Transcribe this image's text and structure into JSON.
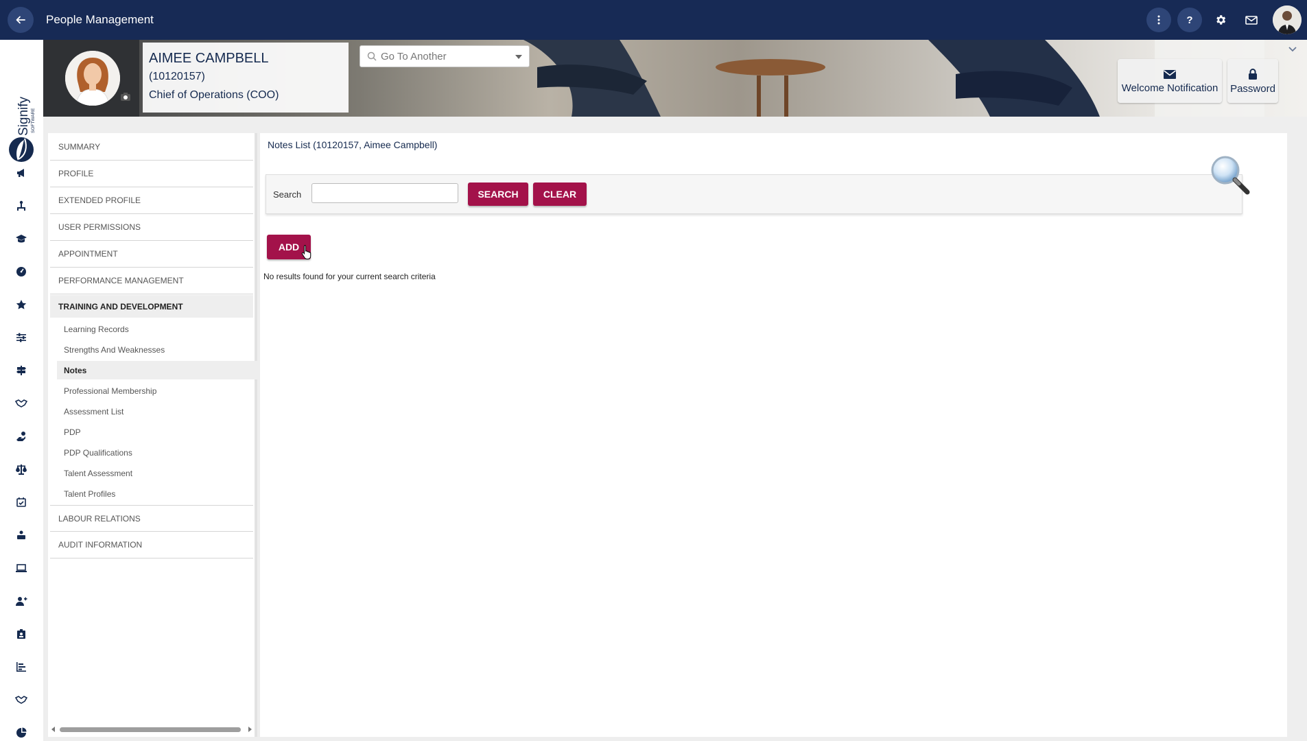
{
  "app": {
    "title": "People Management"
  },
  "employee": {
    "name": "AIMEE CAMPBELL",
    "id": "(10120157)",
    "position": "Chief of Operations (COO)"
  },
  "banner": {
    "goto_placeholder": "Go To Another",
    "welcome_label": "Welcome Notification",
    "password_label": "Password"
  },
  "logo": {
    "brand": "Signify",
    "sub": "SOFTWARE"
  },
  "rail_icons": [
    "megaphone-icon",
    "person-tree-icon",
    "graduation-cap-icon",
    "gauge-icon",
    "star-icon",
    "sliders-icon",
    "signpost-icon",
    "handshake-icon",
    "hand-coins-icon",
    "scales-icon",
    "calendar-check-icon",
    "person-laptop-icon",
    "laptop-icon",
    "user-plus-icon",
    "id-badge-icon",
    "bar-chart-icon",
    "handshake-alt-icon",
    "pie-chart-icon"
  ],
  "sidebar": {
    "items": [
      {
        "label": "SUMMARY"
      },
      {
        "label": "PROFILE"
      },
      {
        "label": "EXTENDED PROFILE"
      },
      {
        "label": "USER PERMISSIONS"
      },
      {
        "label": "APPOINTMENT"
      },
      {
        "label": "PERFORMANCE MANAGEMENT"
      },
      {
        "label": "TRAINING AND DEVELOPMENT"
      },
      {
        "label": "LABOUR RELATIONS"
      },
      {
        "label": "AUDIT INFORMATION"
      }
    ],
    "sub_items": [
      {
        "label": "Learning Records"
      },
      {
        "label": "Strengths And Weaknesses"
      },
      {
        "label": "Notes"
      },
      {
        "label": "Professional Membership"
      },
      {
        "label": "Assessment List"
      },
      {
        "label": "PDP"
      },
      {
        "label": "PDP Qualifications"
      },
      {
        "label": "Talent Assessment"
      },
      {
        "label": "Talent Profiles"
      }
    ]
  },
  "main": {
    "title": "Notes List (10120157, Aimee Campbell)",
    "search_label": "Search",
    "search_value": "",
    "search_button": "SEARCH",
    "clear_button": "CLEAR",
    "add_button": "ADD",
    "empty_message": "No results found for your current search criteria"
  },
  "colors": {
    "topbar": "#172a55",
    "accent": "#a3124a",
    "title_text": "#152a4f"
  }
}
